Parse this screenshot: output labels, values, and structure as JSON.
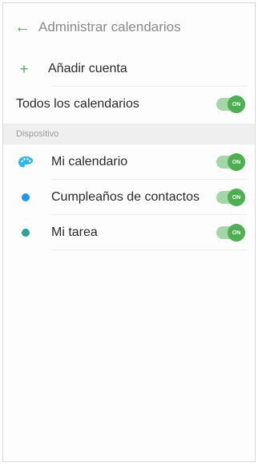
{
  "header": {
    "title": "Administrar calendarios"
  },
  "add_account": {
    "label": "Añadir cuenta"
  },
  "all_calendars": {
    "label": "Todos los calendarios",
    "toggle": "ON"
  },
  "section": {
    "title": "Dispositivo"
  },
  "calendars": [
    {
      "label": "Mi calendario",
      "toggle": "ON",
      "icon": "palette-icon",
      "color": "#29b6f6"
    },
    {
      "label": "Cumpleaños de contactos",
      "toggle": "ON",
      "icon": "dot-icon",
      "color": "#2196f3"
    },
    {
      "label": "Mi tarea",
      "toggle": "ON",
      "icon": "dot-icon",
      "color": "#26a69a"
    }
  ],
  "colors": {
    "accent": "#4caf50",
    "toggle_track": "#a5d6a7"
  }
}
